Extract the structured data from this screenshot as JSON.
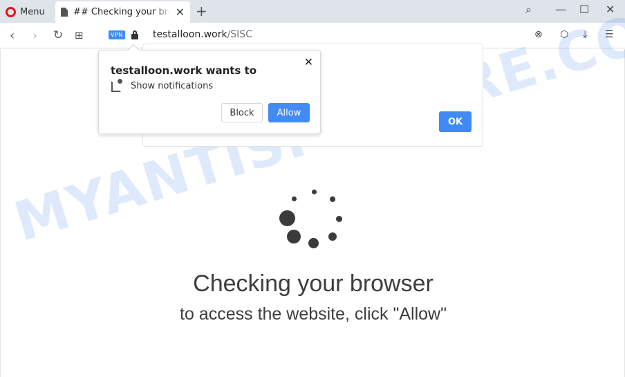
{
  "browser": {
    "menu_label": "Menu",
    "tab_title": "## Checking your browser",
    "new_tab": "+",
    "window_controls": {
      "search": "⌕",
      "minimize": "—",
      "maximize": "☐",
      "close": "✕"
    },
    "tab_close": "✕"
  },
  "addressbar": {
    "back": "‹",
    "forward": "›",
    "reload": "↻",
    "speed_dial": "⊞",
    "vpn_badge": "VPN",
    "url_host": "testalloon.work",
    "url_path": "/SISC",
    "right_icons": {
      "adblock": "⊗",
      "extensions": "⬡",
      "download": "⤓",
      "easy_setup": "☰"
    }
  },
  "permission_popup": {
    "title": "testalloon.work wants to",
    "permission": "Show notifications",
    "close": "✕",
    "block_label": "Block",
    "allow_label": "Allow"
  },
  "page_dialog": {
    "ok_label": "OK"
  },
  "page": {
    "heading": "Checking your browser",
    "subheading": "to access the website, click \"Allow\""
  },
  "watermark": "MYANTISPYWARE.COM",
  "colors": {
    "accent": "#428bf4",
    "tabbar": "#dfe3ea",
    "text": "#3d3d3d"
  }
}
